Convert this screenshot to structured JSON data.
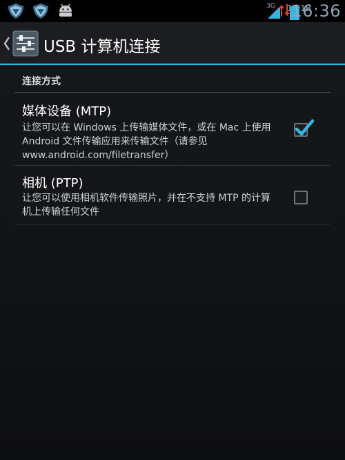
{
  "status_bar": {
    "left_icons": [
      "shield-icon",
      "shield-icon",
      "android-icon"
    ],
    "signal_label": "3G",
    "net_speed": "1.01B",
    "time": "16:36"
  },
  "action_bar": {
    "back_icon": "chevron-left-icon",
    "app_icon": "settings-sliders-icon",
    "title": "USB 计算机连接",
    "accent_color": "#33b5e5"
  },
  "category": {
    "label": "连接方式"
  },
  "options": [
    {
      "title": "媒体设备 (MTP)",
      "summary": "让您可以在 Windows 上传输媒体文件，或在 Mac 上使用 Android 文件传输应用来传输文件（请参见 www.android.com/filetransfer）",
      "checked": true
    },
    {
      "title": "相机 (PTP)",
      "summary": "让您可以使用相机软件传输照片，并在不支持 MTP 的计算机上传输任何文件",
      "checked": false
    }
  ]
}
